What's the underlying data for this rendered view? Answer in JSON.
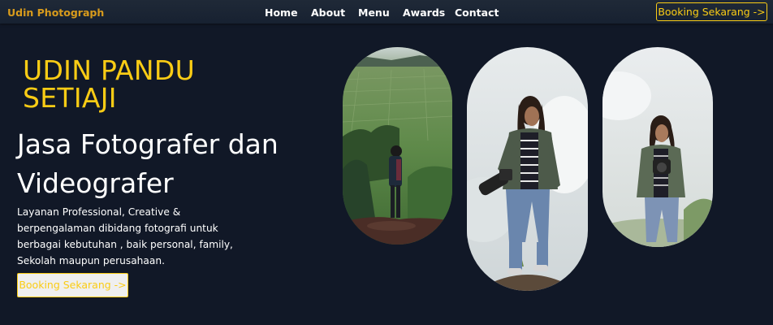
{
  "navbar": {
    "brand": "Udin Photograph",
    "links": [
      "Home",
      "About",
      "Menu",
      "Awards",
      "Contact"
    ],
    "book_label": "Booking Sekarang ->"
  },
  "hero": {
    "name": "UDIN PANDU SETIAJI",
    "title": "Jasa Fotografer dan Videografer",
    "description": "Layanan Professional, Creative & berpengalaman dibidang fotografi untuk berbagai kebutuhan , baik personal, family, Sekolah maupun perusahaan.",
    "book_label": "Booking Sekarang ->"
  },
  "colors": {
    "background": "#111827",
    "accent": "#facc15",
    "brand": "#d89b1c"
  }
}
